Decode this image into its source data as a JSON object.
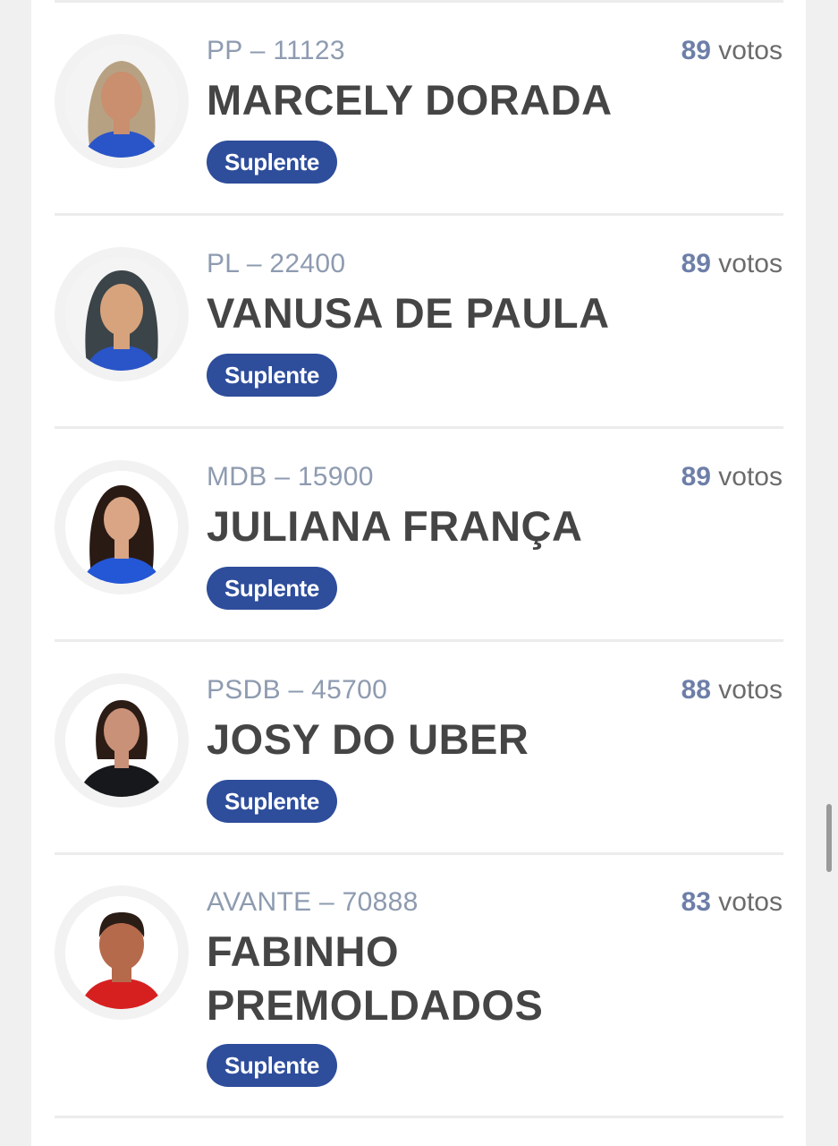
{
  "candidates": [
    {
      "party": "PP – 11123",
      "name": "MARCELY DORADA",
      "votes": "89",
      "votes_label": "votos",
      "status": "Suplente",
      "shirt_color": "#2a55c8",
      "hair_color": "#b7a183",
      "skin_color": "#c98f6e"
    },
    {
      "party": "PL – 22400",
      "name": "VANUSA DE PAULA",
      "votes": "89",
      "votes_label": "votos",
      "status": "Suplente",
      "shirt_color": "#2a55c8",
      "hair_color": "#3b4448",
      "skin_color": "#d6a37d"
    },
    {
      "party": "MDB – 15900",
      "name": "JULIANA FRANÇA",
      "votes": "89",
      "votes_label": "votos",
      "status": "Suplente",
      "shirt_color": "#2457d6",
      "hair_color": "#2a1a14",
      "skin_color": "#d9a585"
    },
    {
      "party": "PSDB – 45700",
      "name": "JOSY DO UBER",
      "votes": "88",
      "votes_label": "votos",
      "status": "Suplente",
      "shirt_color": "#16181c",
      "hair_color": "#2b1c16",
      "skin_color": "#c99178"
    },
    {
      "party": "AVANTE – 70888",
      "name": "FABINHO PREMOLDADOS",
      "votes": "83",
      "votes_label": "votos",
      "status": "Suplente",
      "shirt_color": "#d62020",
      "hair_color": "#2a1d15",
      "skin_color": "#b56a4c"
    }
  ]
}
